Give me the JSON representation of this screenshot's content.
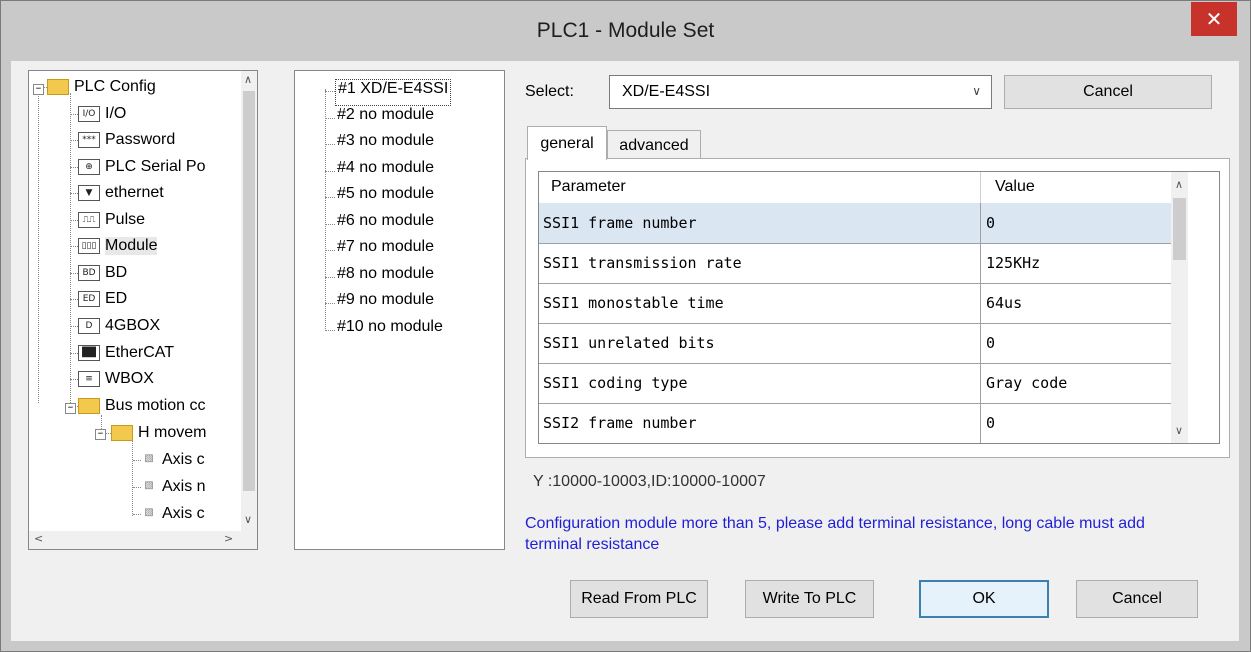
{
  "window": {
    "title": "PLC1 - Module  Set",
    "close_glyph": "✕"
  },
  "tree": {
    "nodes": [
      {
        "label": "PLC Config",
        "icon": "folder-icon"
      },
      {
        "label": "I/O",
        "icon": "io-icon",
        "icon_text": "I/O"
      },
      {
        "label": "Password",
        "icon": "password-icon",
        "icon_text": "***"
      },
      {
        "label": "PLC Serial Po",
        "icon": "serial-port-icon",
        "icon_text": "⊕"
      },
      {
        "label": "ethernet",
        "icon": "ethernet-icon",
        "icon_text": "▼"
      },
      {
        "label": "Pulse",
        "icon": "pulse-icon",
        "icon_text": "⎍⎍"
      },
      {
        "label": "Module",
        "icon": "module-icon",
        "icon_text": "▯▯▯"
      },
      {
        "label": "BD",
        "icon": "bd-icon",
        "icon_text": "BD"
      },
      {
        "label": "ED",
        "icon": "ed-icon",
        "icon_text": "ED"
      },
      {
        "label": "4GBOX",
        "icon": "4gbox-icon",
        "icon_text": "D"
      },
      {
        "label": "EtherCAT",
        "icon": "ethercat-icon",
        "icon_text": "██"
      },
      {
        "label": "WBOX",
        "icon": "wbox-icon",
        "icon_text": "≡"
      },
      {
        "label": "Bus motion cc",
        "icon": "folder-icon"
      },
      {
        "label": "H movem",
        "icon": "folder-icon"
      },
      {
        "label": "Axis c",
        "icon": "axis-icon"
      },
      {
        "label": "Axis n",
        "icon": "axis-icon"
      },
      {
        "label": "Axis c",
        "icon": "axis-icon"
      }
    ],
    "collapse_glyph": "−"
  },
  "modules": [
    "#1 XD/E-E4SSI",
    "#2 no module",
    "#3 no module",
    "#4 no module",
    "#5 no module",
    "#6 no module",
    "#7 no module",
    "#8 no module",
    "#9 no module",
    "#10 no module"
  ],
  "select": {
    "label": "Select:",
    "value": "XD/E-E4SSI"
  },
  "buttons": {
    "cancel_top": "Cancel",
    "read": "Read From PLC",
    "write": "Write To PLC",
    "ok": "OK",
    "cancel": "Cancel"
  },
  "tabs": [
    {
      "label": "general"
    },
    {
      "label": "advanced"
    }
  ],
  "grid": {
    "headers": {
      "param": "Parameter",
      "value": "Value"
    },
    "rows": [
      {
        "param": "SSI1 frame number",
        "value": "0"
      },
      {
        "param": "SSI1 transmission rate",
        "value": "125KHz"
      },
      {
        "param": "SSI1 monostable time",
        "value": "64us"
      },
      {
        "param": "SSI1 unrelated bits",
        "value": "0"
      },
      {
        "param": "SSI1 coding type",
        "value": "Gray code"
      },
      {
        "param": "SSI2 frame number",
        "value": "0"
      }
    ]
  },
  "address_info": "Y :10000-10003,ID:10000-10007",
  "warning": "Configuration module more than 5, please add terminal resistance, long cable must add terminal resistance",
  "scroll_glyphs": {
    "up": "∧",
    "down": "∨",
    "left": "<",
    "right": ">"
  }
}
